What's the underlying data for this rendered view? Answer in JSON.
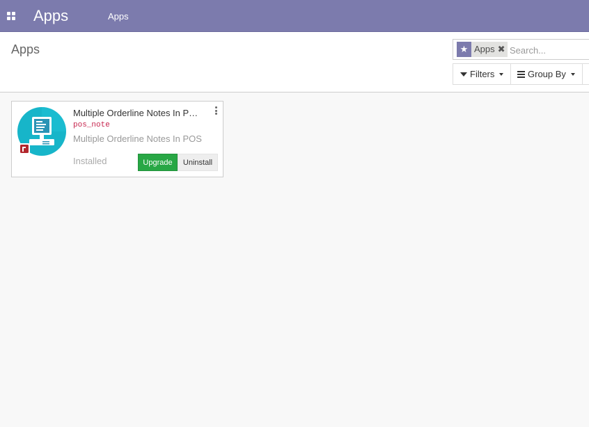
{
  "navbar": {
    "brand": "Apps",
    "menu": [
      "Apps"
    ],
    "icon": "apps-grid-icon",
    "color": "#7c7bad"
  },
  "control_panel": {
    "breadcrumb": "Apps",
    "search": {
      "facet_label": "Apps",
      "facet_icon": "star-icon",
      "placeholder": "Search..."
    },
    "filters_label": "Filters",
    "groupby_label": "Group By"
  },
  "apps": [
    {
      "name": "Multiple Orderline Notes In P…",
      "technical_name": "pos_note",
      "summary": "Multiple Orderline Notes In POS",
      "status": "Installed",
      "upgrade_label": "Upgrade",
      "uninstall_label": "Uninstall",
      "icon": "pos-terminal-icon"
    }
  ],
  "colors": {
    "accent": "#7c7bad",
    "upgrade": "#28a745",
    "tech_name": "#c7254e"
  }
}
